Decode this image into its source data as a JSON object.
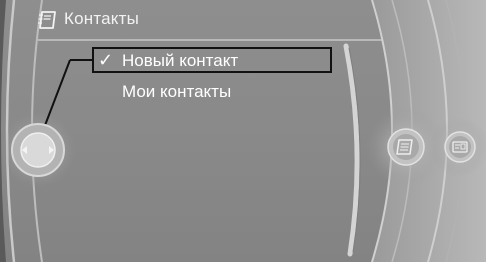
{
  "header": {
    "title": "Контакты",
    "icon": "contacts-book-icon"
  },
  "menu": {
    "items": [
      {
        "label": "Новый контакт",
        "checked": true,
        "selected": true
      },
      {
        "label": "Мои контакты",
        "checked": false,
        "selected": false
      }
    ],
    "check_glyph": "✓"
  },
  "controller": {
    "icon": "controller-knob-icon"
  },
  "side_buttons": [
    {
      "icon": "notes-icon"
    },
    {
      "icon": "card-icon"
    }
  ],
  "colors": {
    "background": "#8a8a8a",
    "text": "#ffffff",
    "selection_border": "#111111"
  }
}
